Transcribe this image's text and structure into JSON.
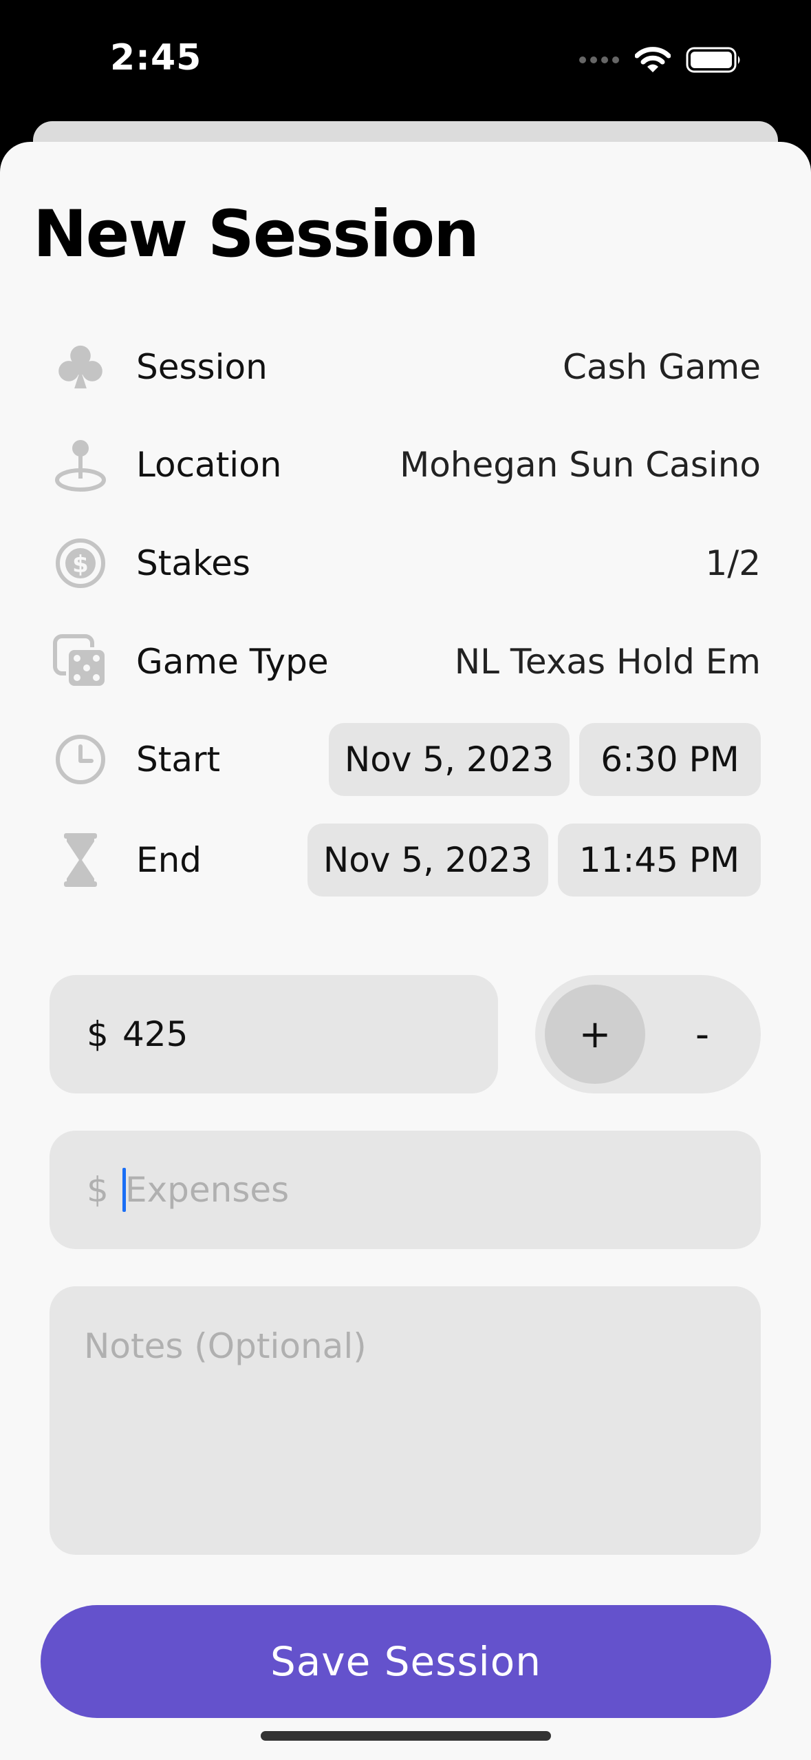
{
  "status_bar": {
    "time": "2:45"
  },
  "sheet": {
    "title": "New Session"
  },
  "rows": {
    "session": {
      "icon": "club-icon",
      "label": "Session",
      "value": "Cash Game"
    },
    "location": {
      "icon": "map-pin-icon",
      "label": "Location",
      "value": "Mohegan Sun Casino"
    },
    "stakes": {
      "icon": "dollar-circle-icon",
      "label": "Stakes",
      "value": "1/2"
    },
    "game_type": {
      "icon": "dice-icon",
      "label": "Game Type",
      "value": "NL Texas Hold Em"
    },
    "start": {
      "icon": "clock-icon",
      "label": "Start",
      "date": "Nov 5, 2023",
      "time": "6:30 PM"
    },
    "end": {
      "icon": "hourglass-icon",
      "label": "End",
      "date": "Nov 5, 2023",
      "time": "11:45 PM"
    }
  },
  "amount": {
    "currency": "$",
    "value": "425"
  },
  "sign_toggle": {
    "plus": "+",
    "minus": "-",
    "selected": "+"
  },
  "expenses": {
    "currency": "$",
    "placeholder": "Expenses"
  },
  "notes": {
    "placeholder": "Notes (Optional)"
  },
  "save_button": {
    "label": "Save Session"
  },
  "colors": {
    "accent": "#6452cc",
    "field": "#e6e6e6",
    "icon_gray": "#c4c4c4",
    "caret": "#1a6ef5"
  }
}
